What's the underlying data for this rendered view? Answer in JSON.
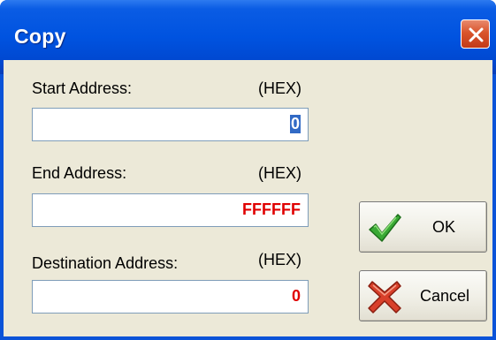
{
  "window": {
    "title": "Copy"
  },
  "fields": {
    "start": {
      "label": "Start Address:",
      "hex": "(HEX)",
      "value": "0"
    },
    "end": {
      "label": "End Address:",
      "hex": "(HEX)",
      "value": "FFFFFF"
    },
    "destination": {
      "label": "Destination Address:",
      "hex": "(HEX)",
      "value": "0"
    }
  },
  "buttons": {
    "ok": {
      "label": "OK",
      "icon": "checkmark-icon"
    },
    "cancel": {
      "label": "Cancel",
      "icon": "x-icon"
    }
  },
  "colors": {
    "titlebar": "#0053e0",
    "value_red": "#e00000",
    "selection": "#316ac5",
    "dialog_bg": "#ece9d8"
  }
}
